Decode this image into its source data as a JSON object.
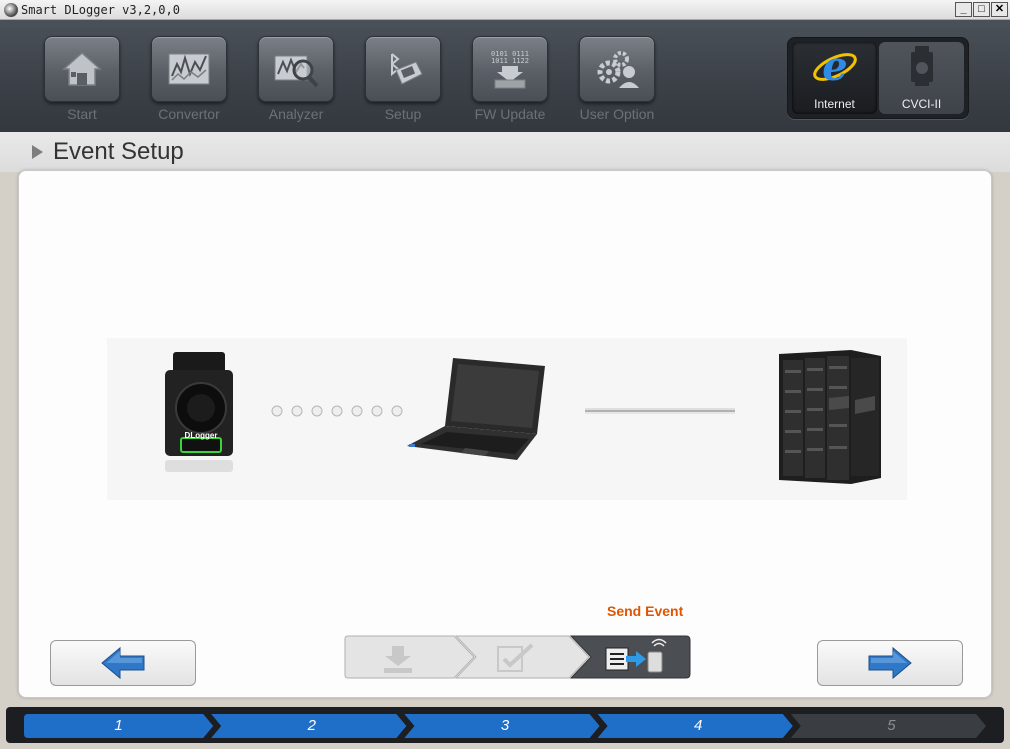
{
  "window": {
    "title": "Smart DLogger v3,2,0,0",
    "minimize": "_",
    "maximize": "□",
    "close": "✕"
  },
  "toolbar": {
    "items": [
      {
        "label": "Start",
        "icon": "home-icon"
      },
      {
        "label": "Convertor",
        "icon": "chart-icon"
      },
      {
        "label": "Analyzer",
        "icon": "magnifier-chart-icon"
      },
      {
        "label": "Setup",
        "icon": "bluetooth-device-icon"
      },
      {
        "label": "FW Update",
        "icon": "chip-download-icon"
      },
      {
        "label": "User Option",
        "icon": "gears-user-icon"
      }
    ],
    "modes": [
      {
        "label": "Internet",
        "icon": "internet-explorer-icon",
        "active": true
      },
      {
        "label": "CVCI-II",
        "icon": "cvci-device-icon",
        "active": false
      }
    ]
  },
  "section": {
    "title": "Event Setup"
  },
  "diagram": {
    "device_label": "DLogger"
  },
  "wizard": {
    "current_step_caption": "Send Event",
    "steps": [
      {
        "icon": "download-icon",
        "state": "inactive"
      },
      {
        "icon": "edit-check-icon",
        "state": "inactive"
      },
      {
        "icon": "send-event-icon",
        "state": "active"
      }
    ]
  },
  "progress": {
    "steps": [
      "1",
      "2",
      "3",
      "4",
      "5"
    ],
    "completed": 4
  },
  "colors": {
    "accent": "#e05500",
    "progress_active": "#1f6fc8",
    "progress_inactive": "#3a3d42",
    "arrow_blue": "#2f78c8"
  }
}
